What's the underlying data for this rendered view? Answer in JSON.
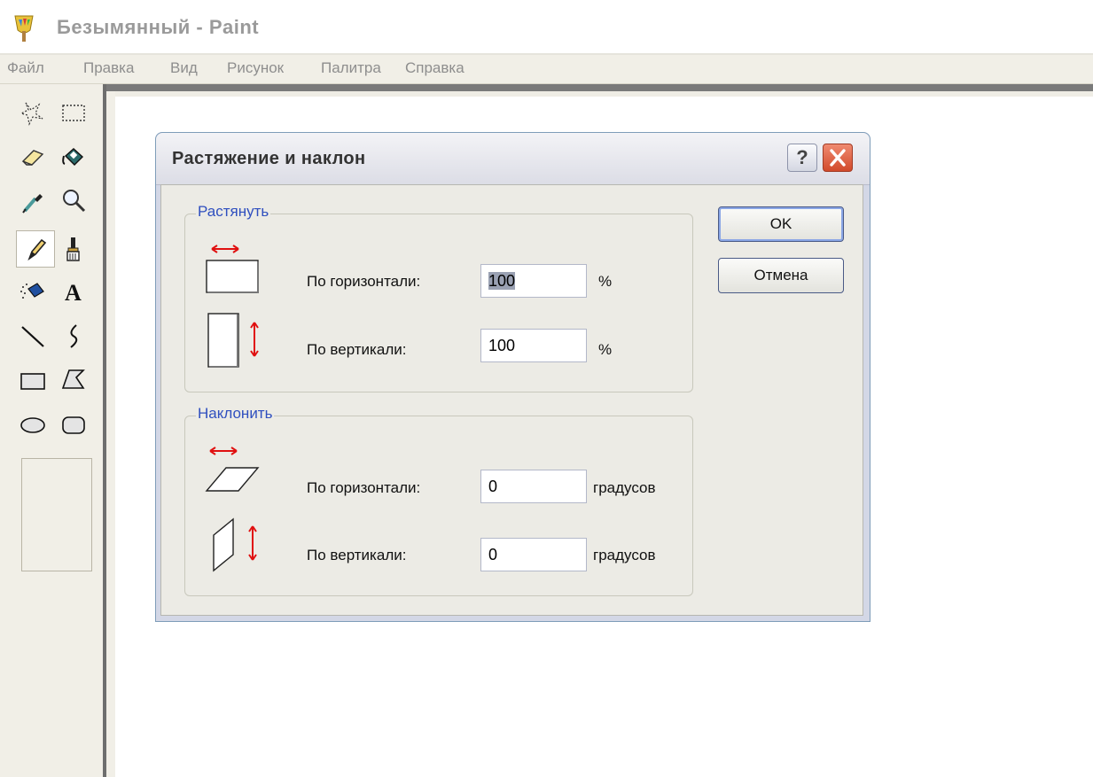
{
  "window": {
    "title": "Безымянный - Paint"
  },
  "menu": [
    "Файл",
    "Правка",
    "Вид",
    "Рисунок",
    "Палитра",
    "Справка"
  ],
  "toolbox": {
    "tools": [
      {
        "name": "free-form-select-icon"
      },
      {
        "name": "rect-select-icon"
      },
      {
        "name": "eraser-icon"
      },
      {
        "name": "fill-bucket-icon"
      },
      {
        "name": "color-picker-icon"
      },
      {
        "name": "magnifier-icon"
      },
      {
        "name": "pencil-icon",
        "selected": true
      },
      {
        "name": "brush-icon"
      },
      {
        "name": "airbrush-icon"
      },
      {
        "name": "text-icon"
      },
      {
        "name": "line-icon"
      },
      {
        "name": "curve-icon"
      },
      {
        "name": "rectangle-icon"
      },
      {
        "name": "polygon-icon"
      },
      {
        "name": "ellipse-icon"
      },
      {
        "name": "rounded-rect-icon"
      }
    ]
  },
  "dialog": {
    "title": "Растяжение и наклон",
    "help_label": "?",
    "stretch": {
      "legend": "Растянуть",
      "horizontal_label": "По горизонтали:",
      "horizontal_value": "100",
      "horizontal_unit": "%",
      "vertical_label": "По вертикали:",
      "vertical_value": "100",
      "vertical_unit": "%"
    },
    "skew": {
      "legend": "Наклонить",
      "horizontal_label": "По горизонтали:",
      "horizontal_value": "0",
      "horizontal_unit": "градусов",
      "vertical_label": "По вертикали:",
      "vertical_value": "0",
      "vertical_unit": "градусов"
    },
    "ok_label": "OK",
    "cancel_label": "Отмена"
  },
  "colors": {
    "dialog_frame": "#d3d7e6",
    "dialog_body": "#ecebe5",
    "group_legend": "#2f4fbf",
    "close_button": "#d24a2b",
    "arrow_red": "#e01010"
  }
}
